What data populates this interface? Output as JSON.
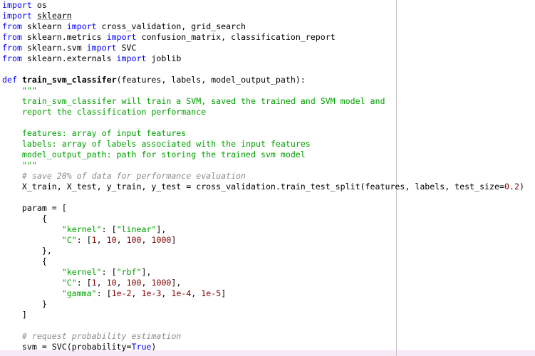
{
  "editor": {
    "lines": [
      [
        {
          "t": "import",
          "c": "kw"
        },
        {
          "t": " os"
        }
      ],
      [
        {
          "t": "import",
          "c": "kw"
        },
        {
          "t": " "
        },
        {
          "t": "sklearn",
          "c": "ul"
        }
      ],
      [
        {
          "t": "from",
          "c": "kw"
        },
        {
          "t": " sklearn "
        },
        {
          "t": "import",
          "c": "kw"
        },
        {
          "t": " cross_validation, grid_search"
        }
      ],
      [
        {
          "t": "from",
          "c": "kw"
        },
        {
          "t": " sklearn.metrics "
        },
        {
          "t": "import",
          "c": "kw"
        },
        {
          "t": " confusion_matrix, classification_report"
        }
      ],
      [
        {
          "t": "from",
          "c": "kw"
        },
        {
          "t": " sklearn.svm "
        },
        {
          "t": "import",
          "c": "kw"
        },
        {
          "t": " SVC"
        }
      ],
      [
        {
          "t": "from",
          "c": "kw"
        },
        {
          "t": " sklearn.externals "
        },
        {
          "t": "import",
          "c": "kw"
        },
        {
          "t": " joblib"
        }
      ],
      [],
      [
        {
          "t": "def",
          "c": "kw"
        },
        {
          "t": " "
        },
        {
          "t": "train_svm_classifer",
          "c": "fn"
        },
        {
          "t": "(features, labels, model_output_path):"
        }
      ],
      [
        {
          "t": "    \"\"\"",
          "c": "doc"
        }
      ],
      [
        {
          "t": "    train_svm_classifer will train a SVM, saved the trained and SVM model and",
          "c": "doc"
        }
      ],
      [
        {
          "t": "    report the classification performance",
          "c": "doc"
        }
      ],
      [],
      [
        {
          "t": "    features: array of input features",
          "c": "doc"
        }
      ],
      [
        {
          "t": "    labels: array of labels associated with the input features",
          "c": "doc"
        }
      ],
      [
        {
          "t": "    model_output_path: path for storing the trained svm model",
          "c": "doc"
        }
      ],
      [
        {
          "t": "    \"\"\"",
          "c": "doc"
        }
      ],
      [
        {
          "t": "    # save 20% of data for performance evaluation",
          "c": "cmt"
        }
      ],
      [
        {
          "t": "    X_train, X_test, y_train, y_test = cross_validation.train_test_split(features, labels, test_size="
        },
        {
          "t": "0.2",
          "c": "num"
        },
        {
          "t": ")"
        }
      ],
      [],
      [
        {
          "t": "    param = ["
        }
      ],
      [
        {
          "t": "        {"
        }
      ],
      [
        {
          "t": "            "
        },
        {
          "t": "\"kernel\"",
          "c": "str"
        },
        {
          "t": ": ["
        },
        {
          "t": "\"linear\"",
          "c": "str"
        },
        {
          "t": "],"
        }
      ],
      [
        {
          "t": "            "
        },
        {
          "t": "\"C\"",
          "c": "str"
        },
        {
          "t": ": ["
        },
        {
          "t": "1",
          "c": "num"
        },
        {
          "t": ", "
        },
        {
          "t": "10",
          "c": "num"
        },
        {
          "t": ", "
        },
        {
          "t": "100",
          "c": "num"
        },
        {
          "t": ", "
        },
        {
          "t": "1000",
          "c": "num"
        },
        {
          "t": "]"
        }
      ],
      [
        {
          "t": "        },"
        }
      ],
      [
        {
          "t": "        {"
        }
      ],
      [
        {
          "t": "            "
        },
        {
          "t": "\"kernel\"",
          "c": "str"
        },
        {
          "t": ": ["
        },
        {
          "t": "\"rbf\"",
          "c": "str"
        },
        {
          "t": "],"
        }
      ],
      [
        {
          "t": "            "
        },
        {
          "t": "\"C\"",
          "c": "str"
        },
        {
          "t": ": ["
        },
        {
          "t": "1",
          "c": "num"
        },
        {
          "t": ", "
        },
        {
          "t": "10",
          "c": "num"
        },
        {
          "t": ", "
        },
        {
          "t": "100",
          "c": "num"
        },
        {
          "t": ", "
        },
        {
          "t": "1000",
          "c": "num"
        },
        {
          "t": "],"
        }
      ],
      [
        {
          "t": "            "
        },
        {
          "t": "\"gamma\"",
          "c": "str"
        },
        {
          "t": ": ["
        },
        {
          "t": "1e-2",
          "c": "num"
        },
        {
          "t": ", "
        },
        {
          "t": "1e-3",
          "c": "num"
        },
        {
          "t": ", "
        },
        {
          "t": "1e-4",
          "c": "num"
        },
        {
          "t": ", "
        },
        {
          "t": "1e-5",
          "c": "num"
        },
        {
          "t": "]"
        }
      ],
      [
        {
          "t": "        }"
        }
      ],
      [
        {
          "t": "    ]"
        }
      ],
      [],
      [
        {
          "t": "    # request probability estimation",
          "c": "cmt"
        }
      ],
      [
        {
          "t": "    svm = SVC(probability="
        },
        {
          "t": "True",
          "c": "kw"
        },
        {
          "t": ")"
        }
      ]
    ]
  }
}
